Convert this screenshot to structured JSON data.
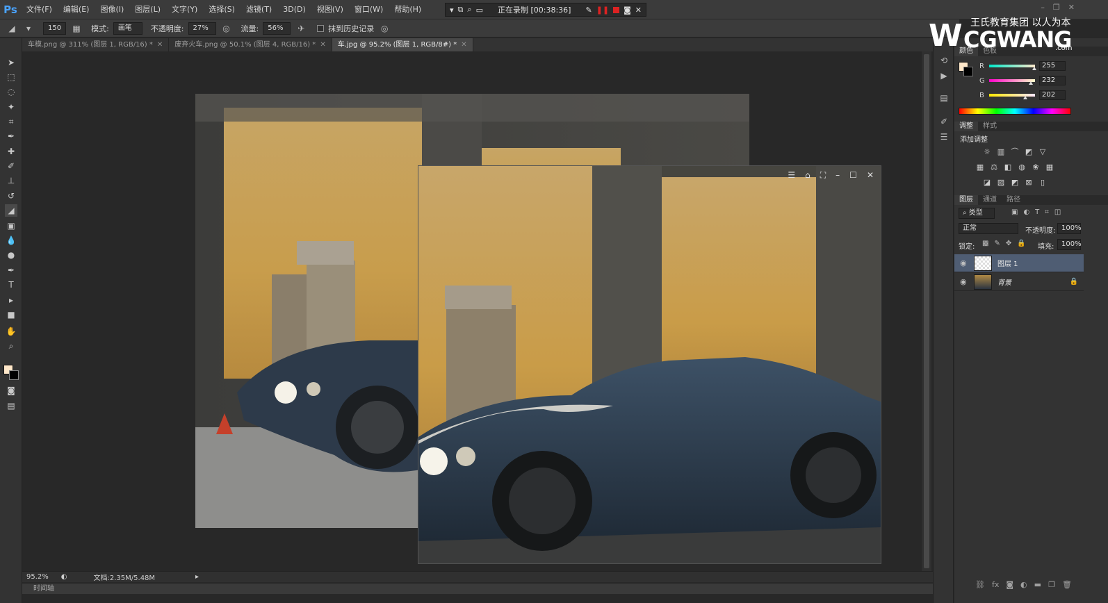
{
  "app": {
    "logo": "Ps"
  },
  "menu": [
    "文件(F)",
    "编辑(E)",
    "图像(I)",
    "图层(L)",
    "文字(Y)",
    "选择(S)",
    "滤镜(T)",
    "3D(D)",
    "视图(V)",
    "窗口(W)",
    "帮助(H)"
  ],
  "recorder": {
    "status": "正在录制 [00:38:36]"
  },
  "options": {
    "brush_size": "150",
    "mode_label": "模式:",
    "mode_value": "画笔",
    "opacity_label": "不透明度:",
    "opacity_value": "27%",
    "flow_label": "流量:",
    "flow_value": "56%",
    "erase_history_label": "抹到历史记录"
  },
  "tabs": [
    {
      "label": "车模.png @ 311% (图层 1, RGB/16) *",
      "active": false
    },
    {
      "label": "废弃火车.png @ 50.1% (图层 4, RGB/16) *",
      "active": false
    },
    {
      "label": "车.jpg @ 95.2% (图层 1, RGB/8#) *",
      "active": true
    }
  ],
  "status": {
    "zoom": "95.2%",
    "doc": "文档:2.35M/5.48M"
  },
  "timeline_label": "时间轴",
  "watermark": {
    "tagline": "王氏教育集团 以人为本",
    "brand": "CGWANG",
    "domain": ".com"
  },
  "color_panel": {
    "tabs": [
      "颜色",
      "色板"
    ],
    "fg_color": "#ffe8ca",
    "channels": [
      {
        "name": "R",
        "value": "255"
      },
      {
        "name": "G",
        "value": "232"
      },
      {
        "name": "B",
        "value": "202"
      }
    ]
  },
  "adjust_panel": {
    "tabs": [
      "调整",
      "样式"
    ],
    "title": "添加调整"
  },
  "layers_panel": {
    "tabs": [
      "图层",
      "通道",
      "路径"
    ],
    "filter_label": "类型",
    "blend_mode": "正常",
    "opacity_label": "不透明度:",
    "opacity_value": "100%",
    "lock_label": "锁定:",
    "fill_label": "填充:",
    "fill_value": "100%",
    "layers": [
      {
        "name": "图层 1",
        "selected": true
      },
      {
        "name": "背景",
        "selected": false,
        "locked": true
      }
    ]
  }
}
